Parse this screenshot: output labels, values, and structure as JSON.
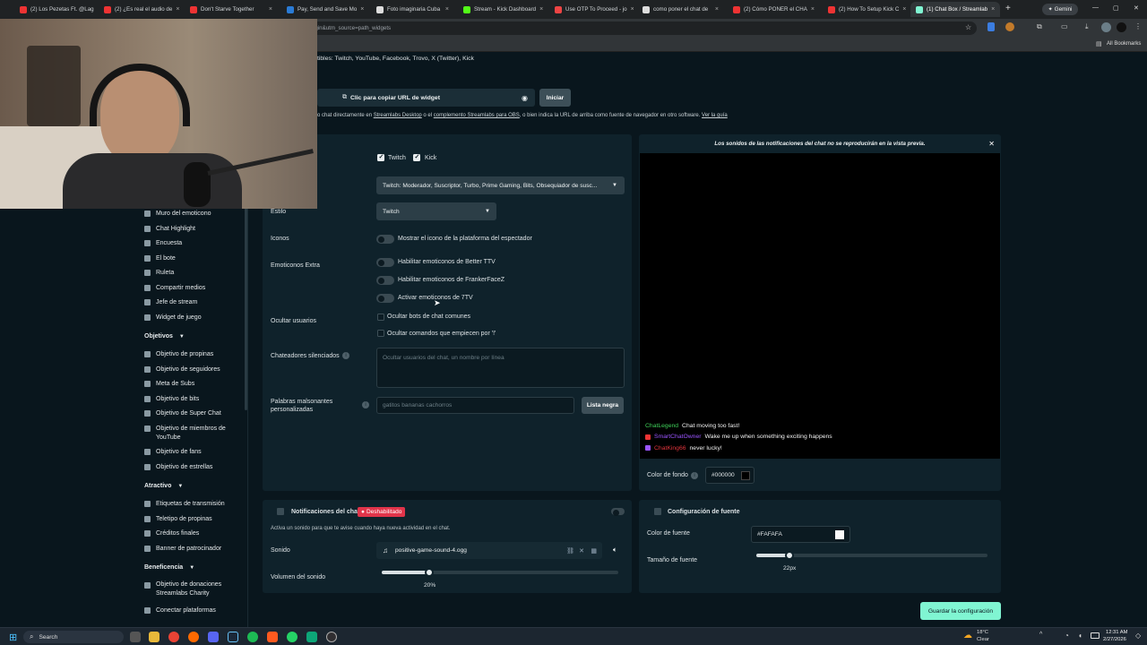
{
  "browser": {
    "tabs": [
      {
        "label": "(2) Los Pezetas Ft. @Lag",
        "color": "#e33"
      },
      {
        "label": "(2) ¿Es real el audio de",
        "color": "#e33"
      },
      {
        "label": "Don't Starve Together",
        "color": "#e33"
      },
      {
        "label": "Pay, Send and Save Mo",
        "color": "#2a7bd5"
      },
      {
        "label": "Foto imaginaria Cuba",
        "color": "#ddd"
      },
      {
        "label": "Stream - Kick Dashboard",
        "color": "#53fc18"
      },
      {
        "label": "Use OTP To Proceed - jo",
        "color": "#e44"
      },
      {
        "label": "como poner el chat de",
        "color": "#ddd"
      },
      {
        "label": "(2) Cómo PONER el CHA",
        "color": "#e33"
      },
      {
        "label": "(2) How To Setup Kick C",
        "color": "#e33"
      },
      {
        "label": "(1) Chat Box / Streamlab",
        "color": "#80f5d2"
      }
    ],
    "gemini_label": "Gemini",
    "address": "streamlabs.com/dashboard#/widgets/chat-box?utm_campaign=obs_plugin&utm_medium=obs_plugin&utm_source=path_widgets",
    "all_bookmarks": "All Bookmarks"
  },
  "top": {
    "compatible": "tibles: Twitch, YouTube, Facebook, Trovo, X (Twitter), Kick",
    "copy_url": "Clic para copiar URL de widget",
    "start": "Iniciar",
    "hint_pre": "o chat directamente en ",
    "hint_link1": "Streamlabs Desktop",
    "hint_mid": " o el ",
    "hint_link2": "complemento Streamlabs para OBS",
    "hint_post": ", o bien indica la URL de arriba como fuente de navegador en otro software. ",
    "hint_link3": "Ver la guía"
  },
  "sidebar": {
    "items_top": [
      "Muro del emoticono",
      "Chat Highlight",
      "Encuesta",
      "El bote",
      "Ruleta",
      "Compartir medios",
      "Jefe de stream",
      "Widget de juego"
    ],
    "objetivos_header": "Objetivos",
    "objetivos": [
      "Objetivo de propinas",
      "Objetivo de seguidores",
      "Meta de Subs",
      "Objetivo de bits",
      "Objetivo de Super Chat",
      "Objetivo de miembros de YouTube",
      "Objetivo de fans",
      "Objetivo de estrellas"
    ],
    "atractivo_header": "Atractivo",
    "atractivo": [
      "Etiquetas de transmisión",
      "Teletipo de propinas",
      "Créditos finales",
      "Banner de patrocinador"
    ],
    "beneficencia_header": "Beneficencia",
    "beneficencia": [
      "Objetivo de donaciones Streamlabs Charity"
    ],
    "connect": "Conectar plataformas"
  },
  "settings": {
    "platform_twitch": "Twitch",
    "platform_kick": "Kick",
    "badges_select": "Twitch: Moderador, Suscriptor, Turbo, Prime Gaming, Bits, Obsequiador de susc...",
    "style_label": "Estilo",
    "style_value": "Twitch",
    "icons_label": "Iconos",
    "icons_toggle": "Mostrar el icono de la plataforma del espectador",
    "emotes_label": "Emoticonos Extra",
    "emote_bttv": "Habilitar emoticonos de Better TTV",
    "emote_ffz": "Habilitar emoticonos de FrankerFaceZ",
    "emote_7tv": "Activar emoticonos de 7TV",
    "hide_users_label": "Ocultar usuarios",
    "hide_bots": "Ocultar bots de chat comunes",
    "hide_cmds": "Ocultar comandos que empiecen por '!'",
    "muted_label": "Chateadores silenciados",
    "muted_placeholder": "Ocultar usuarios del chat, un nombre por línea",
    "badwords_label": "Palabras malsonantes personalizadas",
    "badwords_placeholder": "gatitos bananas cachorros",
    "blacklist": "Lista negra"
  },
  "preview": {
    "notice": "Los sonidos de las notificaciones del chat no se reproducirán en la vista previa.",
    "messages": [
      {
        "user": "ChatLegend",
        "text": "Chat moving too fast!",
        "color": "#3fd25a",
        "badge": ""
      },
      {
        "user": "SmartChatOwner",
        "text": "Wake me up when something exciting happens",
        "color": "#9b55ff",
        "badge": "#e33"
      },
      {
        "user": "ChatKing66",
        "text": "never lucky!",
        "color": "#e1343c",
        "badge": "#9b55ff"
      }
    ],
    "bg_label": "Color de fondo",
    "bg_value": "#000000"
  },
  "notifications": {
    "title": "Notificaciones del chat",
    "status": "Deshabilitado",
    "desc": "Activa un sonido para que te avise cuando haya nueva actividad en el chat.",
    "sound_label": "Sonido",
    "sound_file": "positive-game-sound-4.ogg",
    "volume_label": "Volumen del sonido",
    "volume_value": "20%",
    "volume_level": 0.2
  },
  "font": {
    "title": "Configuración de fuente",
    "color_label": "Color de fuente",
    "color_value": "#FAFAFA",
    "size_label": "Tamaño de fuente",
    "size_value": "22px"
  },
  "save_button": "Guardar la configuración",
  "taskbar": {
    "search": "Search",
    "temp": "18°C",
    "weather": "Clear",
    "time": "12:31 AM",
    "date": "2/27/2026"
  }
}
